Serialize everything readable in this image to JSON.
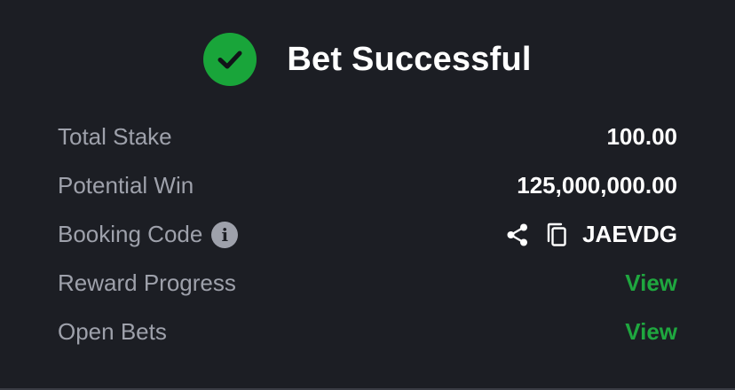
{
  "header": {
    "title": "Bet Successful",
    "icon": "check-circle-icon",
    "accent": "#19a53a"
  },
  "rows": {
    "total_stake": {
      "label": "Total Stake",
      "value": "100.00"
    },
    "potential_win": {
      "label": "Potential Win",
      "value": "125,000,000.00"
    },
    "booking_code": {
      "label": "Booking Code",
      "info_icon": "i",
      "value": "JAEVDG"
    },
    "reward_progress": {
      "label": "Reward Progress",
      "link": "View"
    },
    "open_bets": {
      "label": "Open Bets",
      "link": "View"
    }
  },
  "colors": {
    "background": "#1c1e24",
    "label": "#9ea1ab",
    "value": "#ffffff",
    "link": "#1fa73f"
  }
}
